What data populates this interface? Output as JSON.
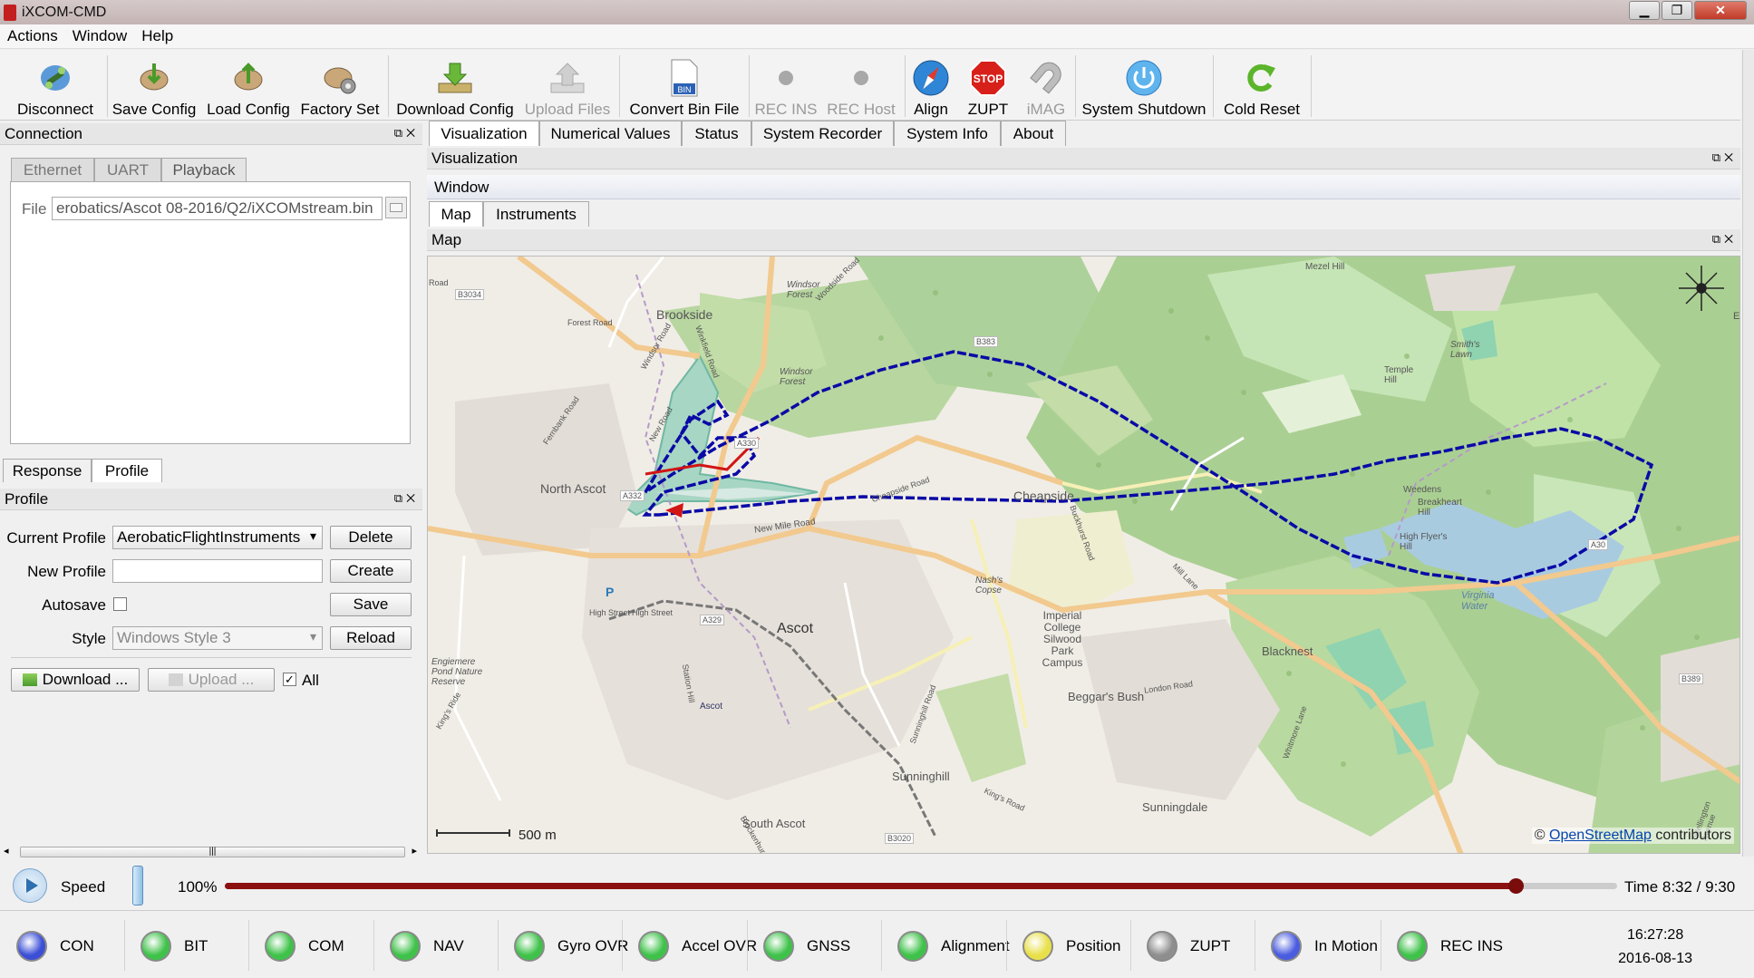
{
  "window": {
    "title": "iXCOM-CMD"
  },
  "menu": [
    "Actions",
    "Window",
    "Help"
  ],
  "toolbar": {
    "disconnect": "Disconnect",
    "save_config": "Save Config",
    "load_config": "Load Config",
    "factory_set": "Factory Set",
    "download_config": "Download Config",
    "upload_files": "Upload Files",
    "convert_bin": "Convert Bin File",
    "bin_badge": "BIN",
    "rec_ins": "REC INS",
    "rec_host": "REC Host",
    "align": "Align",
    "zupt": "ZUPT",
    "stop_badge": "STOP",
    "imag": "iMAG",
    "system_shutdown": "System Shutdown",
    "cold_reset": "Cold Reset"
  },
  "connection": {
    "header": "Connection",
    "tabs": [
      "Ethernet",
      "UART",
      "Playback"
    ],
    "file_label": "File",
    "file_value": "erobatics/Ascot 08-2016/Q2/iXCOMstream.bin"
  },
  "lower_tabs": [
    "Response",
    "Profile"
  ],
  "profile": {
    "header": "Profile",
    "current_label": "Current Profile",
    "current_value": "AerobaticFlightInstruments",
    "delete": "Delete",
    "new_label": "New Profile",
    "new_value": "",
    "create": "Create",
    "autosave_label": "Autosave",
    "save": "Save",
    "style_label": "Style",
    "style_value": "Windows Style 3",
    "reload": "Reload",
    "download": "Download ...",
    "upload": "Upload ...",
    "all_label": "All"
  },
  "main_tabs": [
    "Visualization",
    "Numerical Values",
    "Status",
    "System Recorder",
    "System Info",
    "About"
  ],
  "visualization": {
    "header": "Visualization",
    "window_label": "Window",
    "subtabs": [
      "Map",
      "Instruments"
    ],
    "map_header": "Map"
  },
  "map": {
    "scale": "500 m",
    "attribution_prefix": "© ",
    "attribution_link": "OpenStreetMap",
    "attribution_suffix": " contributors",
    "places": {
      "brookside": "Brookside",
      "north_ascot": "North Ascot",
      "ascot": "Ascot",
      "cheapside": "Cheapside",
      "windsor_forest": "Windsor Forest",
      "windsor_forest2": "Windsor Forest",
      "imperial": "Imperial College Silwood Park Campus",
      "blacknest": "Blacknest",
      "beggars_bush": "Beggar's Bush",
      "sunninghill": "Sunninghill",
      "sunningdale": "Sunningdale",
      "south_ascot": "South Ascot",
      "mezel_hill": "Mezel Hill",
      "temple_hill": "Temple Hill",
      "smiths_lawn": "Smith's Lawn",
      "breakheart_hill": "Breakheart Hill",
      "high_flyers_hill": "High Flyer's Hill",
      "weedens": "Weedens",
      "virginia_water": "Virginia Water",
      "nashs_copse": "Nash's Copse",
      "engiemere": "Engiemere Pond Nature Reserve",
      "ascot_station": "Ascot",
      "high_street": "High Street",
      "high_street2": "High Street",
      "a332": "A332",
      "a330": "A330",
      "a329": "A329",
      "a30": "A30",
      "b383": "B383",
      "b3034": "B3034",
      "b3020": "B3020",
      "b389": "B389",
      "p_marker": "P",
      "road_windsor": "Windsor Road",
      "road_forest": "Forest Road",
      "road_new": "New Road",
      "road_fernbank": "Fernbank Road",
      "road_new_mile": "New Mile Road",
      "road_cheapside": "Cheapside Road",
      "road_london": "London Road",
      "road_kings_ride": "King's Ride",
      "road_mill_lane": "Mill Lane",
      "road_sunninghill": "Sunninghill Road",
      "road_winkfield": "Winkfield Road",
      "road_buckhurst": "Buckhurst Road",
      "road_kings_road": "King's Road",
      "road_woodside": "Woodside Road",
      "road_station_hill": "Station Hill",
      "road_whitmore": "Whitmore Lane",
      "road_wellington": "Wellington Avenue",
      "road_brockenhurst": "Brockenhurst",
      "road_corner": "Road",
      "edge_e": "E"
    }
  },
  "playback": {
    "speed_label": "Speed",
    "speed_value": "100%",
    "progress": 0.927,
    "time_label": "Time 8:32 / 9:30"
  },
  "status": {
    "indicators": [
      {
        "label": "CON",
        "color": "#3b4fd6"
      },
      {
        "label": "BIT",
        "color": "#3fc24a"
      },
      {
        "label": "COM",
        "color": "#3fc24a"
      },
      {
        "label": "NAV",
        "color": "#3fc24a"
      },
      {
        "label": "Gyro OVR",
        "color": "#3fc24a"
      },
      {
        "label": "Accel OVR",
        "color": "#3fc24a"
      },
      {
        "label": "GNSS",
        "color": "#3fc24a"
      },
      {
        "label": "Alignment",
        "color": "#3fc24a"
      },
      {
        "label": "Position",
        "color": "#e8e04a"
      },
      {
        "label": "ZUPT",
        "color": "#8e8e8e"
      },
      {
        "label": "In Motion",
        "color": "#4a5ce0"
      },
      {
        "label": "REC INS",
        "color": "#3fc24a"
      }
    ],
    "time": "16:27:28",
    "date": "2016-08-13"
  }
}
